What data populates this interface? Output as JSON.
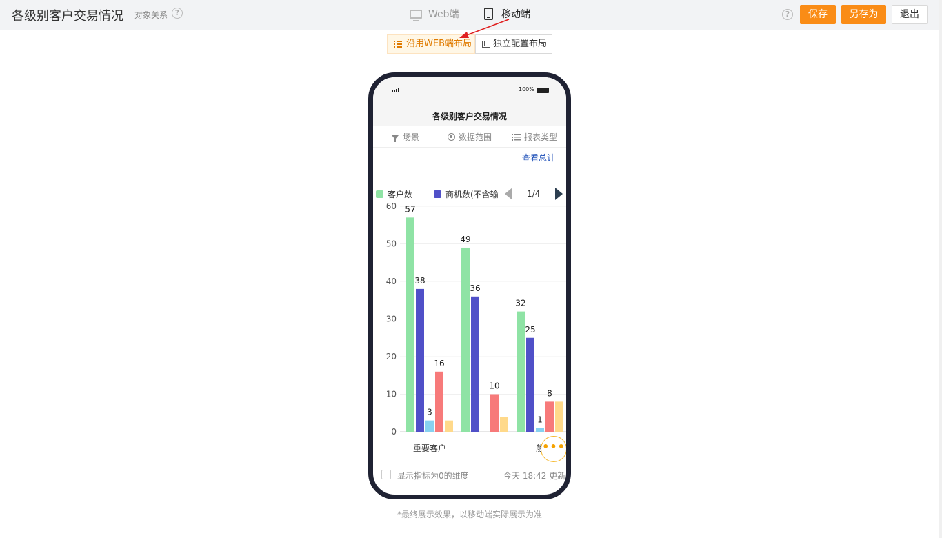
{
  "header": {
    "title": "各级别客户交易情况",
    "relation_label": "对象关系",
    "help_icon": "question-circle-icon",
    "mode_web": "Web端",
    "mode_mobile": "移动端",
    "save_label": "保存",
    "save_as_label": "另存为",
    "exit_label": "退出"
  },
  "layout_toggle": {
    "web_layout": "沿用WEB端布局",
    "independent_layout": "独立配置布局"
  },
  "phone": {
    "battery": "100%",
    "report_title": "各级别客户交易情况",
    "filters": [
      "场景",
      "数据范围",
      "报表类型"
    ],
    "view_total": "查看总计",
    "legend": [
      {
        "name": "客户数",
        "color": "#8fe3a5"
      },
      {
        "name": "商机数(不含输",
        "color": "#5050c8"
      }
    ],
    "pager": "1/4",
    "more_label": "•••",
    "show_zero_label": "显示指标为0的维度",
    "update_time": "今天 18:42 更新"
  },
  "colors": {
    "accent": "#fa8c16",
    "series": [
      "#8fe3a5",
      "#5050c8",
      "#87d1f0",
      "#f77a7a",
      "#ffd98a"
    ]
  },
  "chart_data": {
    "type": "bar",
    "categories": [
      "重要客户",
      "",
      "一般客户"
    ],
    "category_labels_visible": [
      "重要客户",
      "",
      "一般客"
    ],
    "ylim": [
      0,
      60
    ],
    "yticks": [
      0,
      10,
      20,
      30,
      40,
      50,
      60
    ],
    "series": [
      {
        "name": "客户数",
        "values": [
          57,
          49,
          32
        ]
      },
      {
        "name": "商机数(不含输",
        "values": [
          38,
          36,
          25
        ]
      },
      {
        "values": [
          3,
          null,
          1
        ]
      },
      {
        "values": [
          16,
          10,
          8
        ]
      },
      {
        "values": [
          3,
          4,
          8
        ]
      }
    ],
    "value_labels": [
      [
        57,
        38,
        3,
        16,
        null
      ],
      [
        49,
        36,
        null,
        10,
        null
      ],
      [
        32,
        25,
        1,
        8,
        null
      ]
    ]
  },
  "note": "*最终展示效果，以移动端实际展示为准"
}
